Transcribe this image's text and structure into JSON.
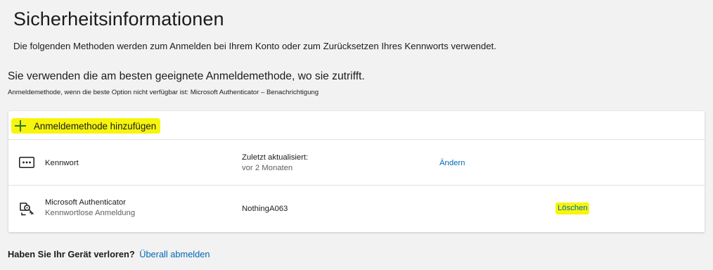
{
  "page": {
    "title": "Sicherheitsinformationen",
    "subtitle": "Die folgenden Methoden werden zum Anmelden bei Ihrem Konto oder zum Zurücksetzen Ihres Kennworts verwendet."
  },
  "default_method": {
    "heading": "Sie verwenden die am besten geeignete Anmeldemethode, wo sie zutrifft.",
    "fallback": "Anmeldemethode, wenn die beste Option nicht verfügbar ist: Microsoft Authenticator – Benachrichtigung"
  },
  "add_method": {
    "label": "Anmeldemethode hinzufügen",
    "icon": "plus-icon"
  },
  "methods": [
    {
      "icon": "password-icon",
      "name": "Kennwort",
      "description": "",
      "detail_label": "Zuletzt aktualisiert:",
      "detail_value": "vor 2 Monaten",
      "action": "Ändern"
    },
    {
      "icon": "authenticator-icon",
      "name": "Microsoft Authenticator",
      "description": "Kennwortlose Anmeldung",
      "detail_label": "",
      "detail_value": "NothingA063",
      "action": "Löschen"
    }
  ],
  "lost_device": {
    "question": "Haben Sie Ihr Gerät verloren?",
    "link": "Überall abmelden"
  },
  "colors": {
    "background": "#f2f2f2",
    "card": "#ffffff",
    "link": "#0067b8",
    "highlight": "#f7f50e",
    "plus": "#2b7a2b"
  }
}
